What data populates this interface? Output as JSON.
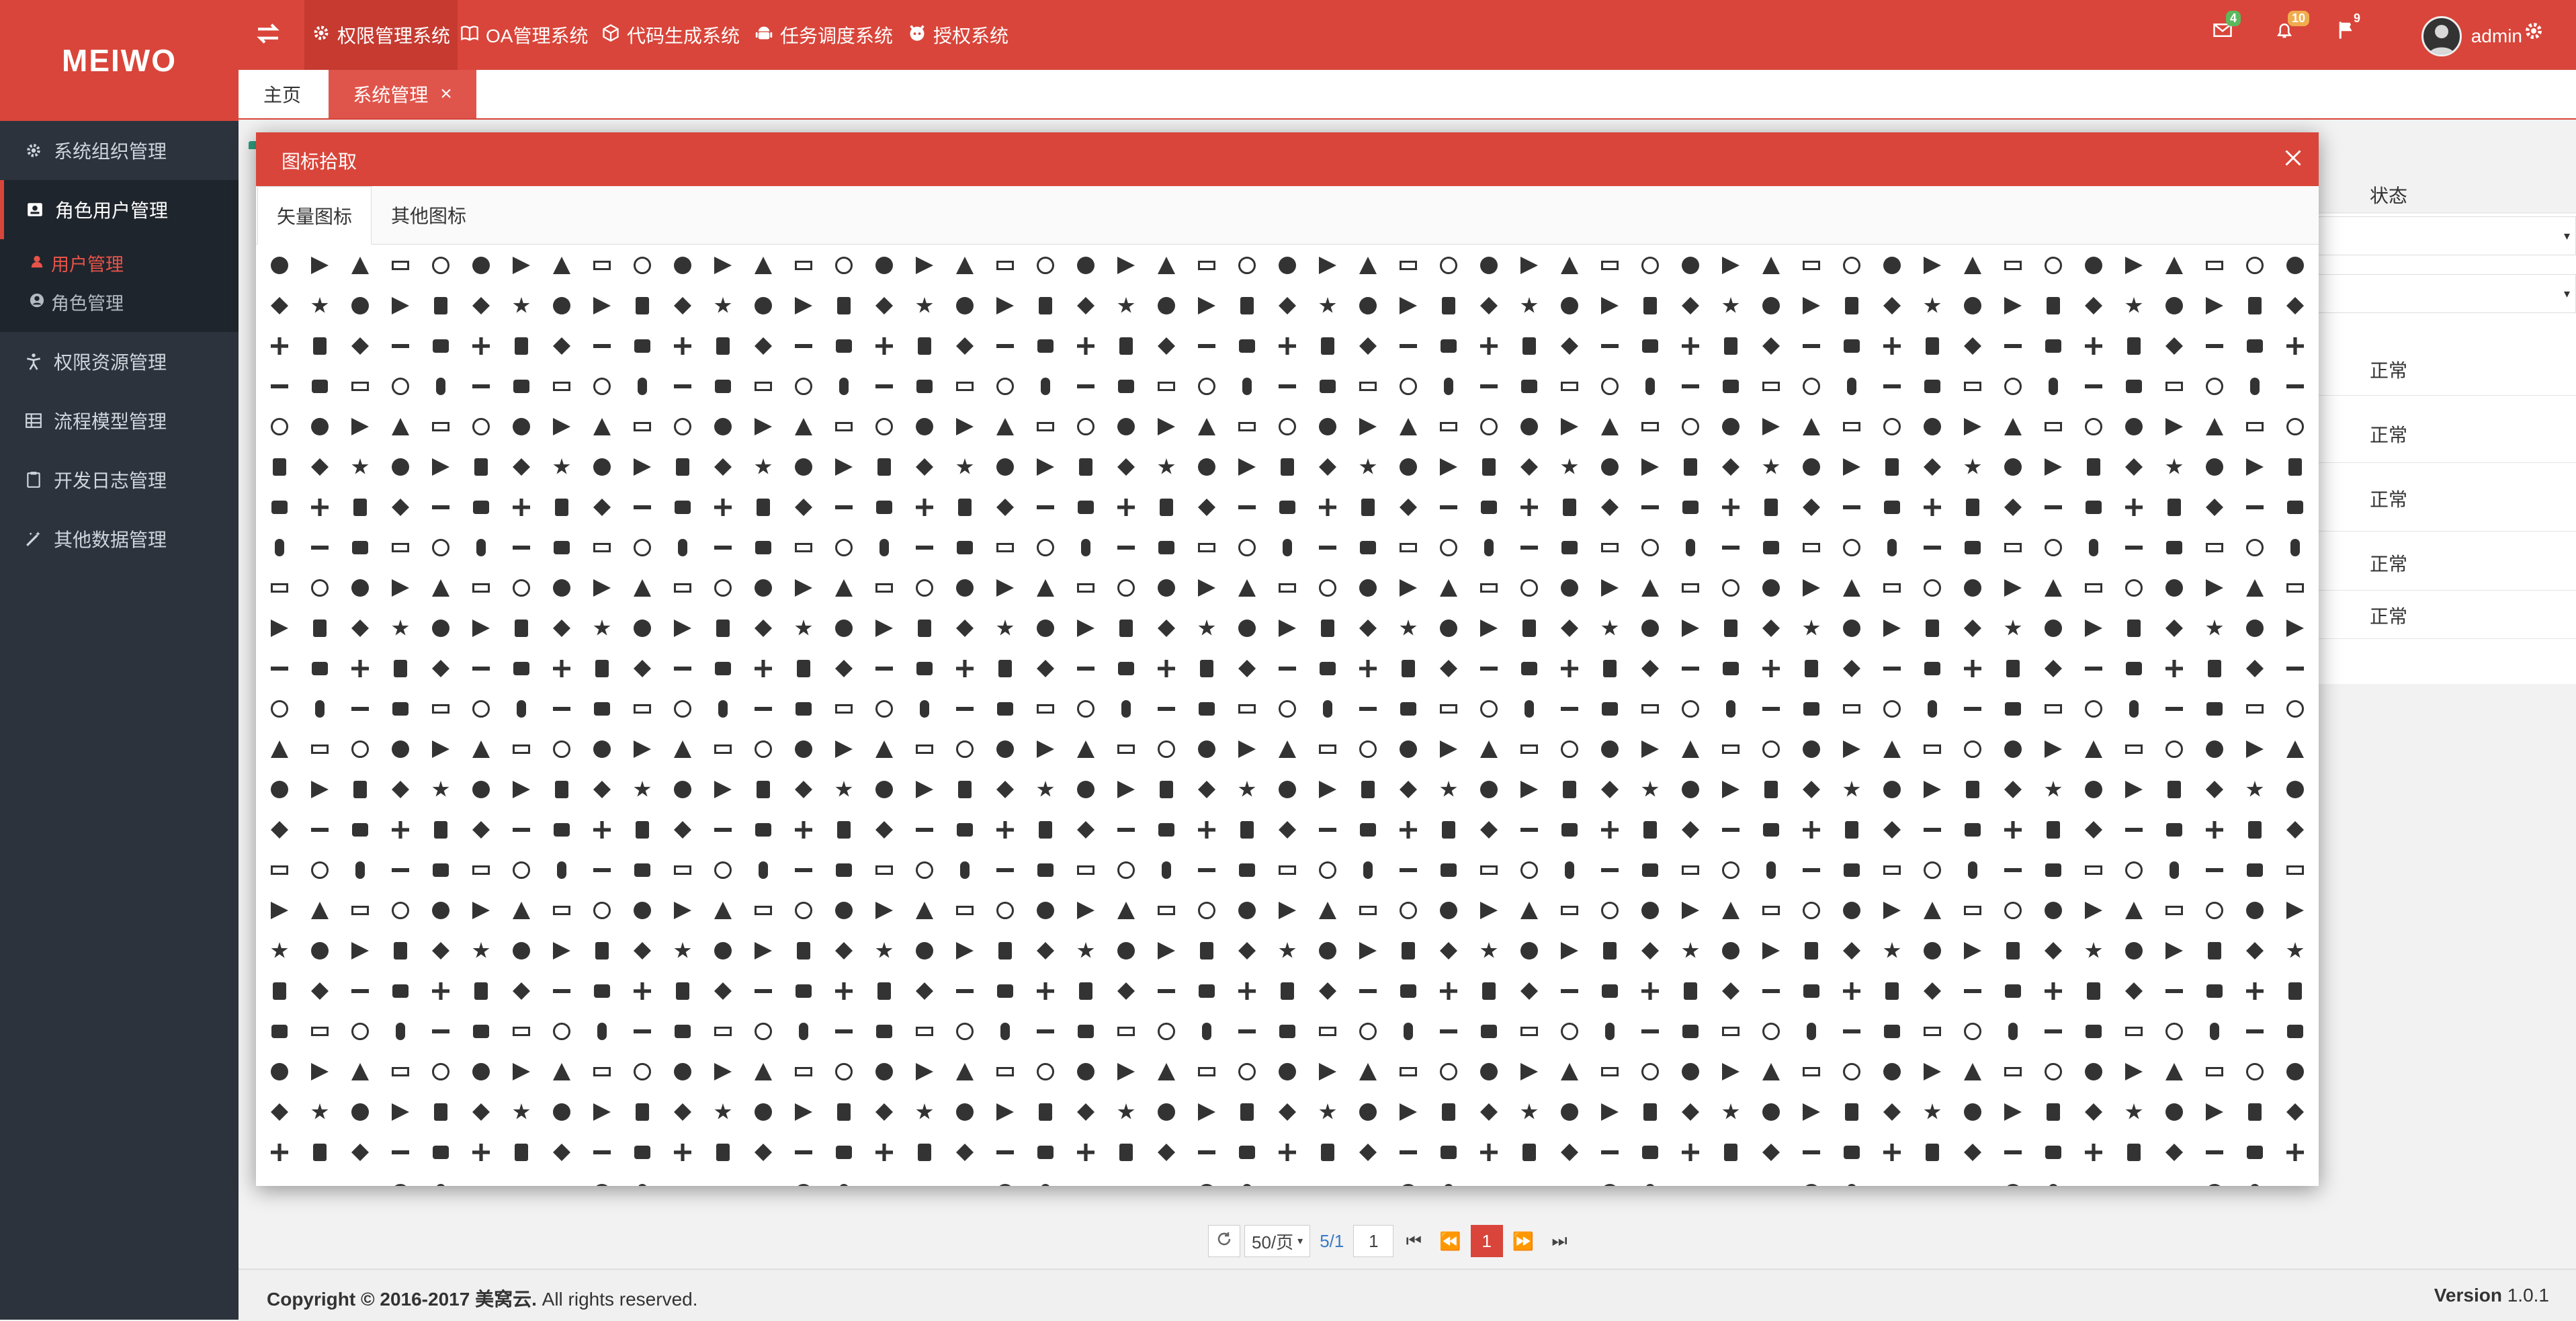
{
  "app": {
    "logo": "MEIWO"
  },
  "sidebar": {
    "items": [
      {
        "label": "系统组织管理",
        "icon": "gear-icon"
      },
      {
        "label": "角色用户管理",
        "icon": "contact-card-icon",
        "active": true,
        "children": [
          {
            "label": "用户管理",
            "icon": "user-icon",
            "active": true
          },
          {
            "label": "角色管理",
            "icon": "user-circle-icon"
          }
        ]
      },
      {
        "label": "权限资源管理",
        "icon": "accessibility-icon"
      },
      {
        "label": "流程模型管理",
        "icon": "table-icon"
      },
      {
        "label": "开发日志管理",
        "icon": "clipboard-icon"
      },
      {
        "label": "其他数据管理",
        "icon": "magic-wand-icon"
      }
    ]
  },
  "topbar": {
    "systems": [
      {
        "label": "权限管理系统",
        "icon": "gear-icon",
        "active": true
      },
      {
        "label": "OA管理系统",
        "icon": "book-icon"
      },
      {
        "label": "代码生成系统",
        "icon": "cube-icon"
      },
      {
        "label": "任务调度系统",
        "icon": "android-icon"
      },
      {
        "label": "授权系统",
        "icon": "github-icon"
      }
    ],
    "notifications": [
      {
        "icon": "envelope-icon",
        "count": "4",
        "color": "#5cb85c"
      },
      {
        "icon": "bell-icon",
        "count": "10",
        "color": "#f0ad4e"
      },
      {
        "icon": "flag-icon",
        "count": "9",
        "color": "#d9453a"
      }
    ],
    "user": {
      "name": "admin"
    }
  },
  "tabs": [
    {
      "label": "主页",
      "active": false
    },
    {
      "label": "系统管理",
      "active": true,
      "close": "×"
    }
  ],
  "table": {
    "column": "状态",
    "statuses": [
      "正常",
      "正常",
      "正常",
      "正常",
      "正常"
    ]
  },
  "modal": {
    "title": "图标拾取",
    "tabs": [
      {
        "label": "矢量图标",
        "active": true
      },
      {
        "label": "其他图标",
        "active": false
      }
    ],
    "icon_grid": {
      "icon": "icon-glyph",
      "count": 1364
    }
  },
  "pagination": {
    "refresh_icon": "refresh-icon",
    "page_size": "50/页",
    "page_info": "5/1",
    "jump_value": "1",
    "current": "1"
  },
  "footer": {
    "copyright_bold": "Copyright © 2016-2017 美窝云.",
    "copyright_rest": " All rights reserved.",
    "version_label": "Version",
    "version": "1.0.1"
  },
  "colors": {
    "brand": "#d9453a",
    "sidebar": "#2c333d",
    "accent_strip": "#2f9c7d"
  }
}
